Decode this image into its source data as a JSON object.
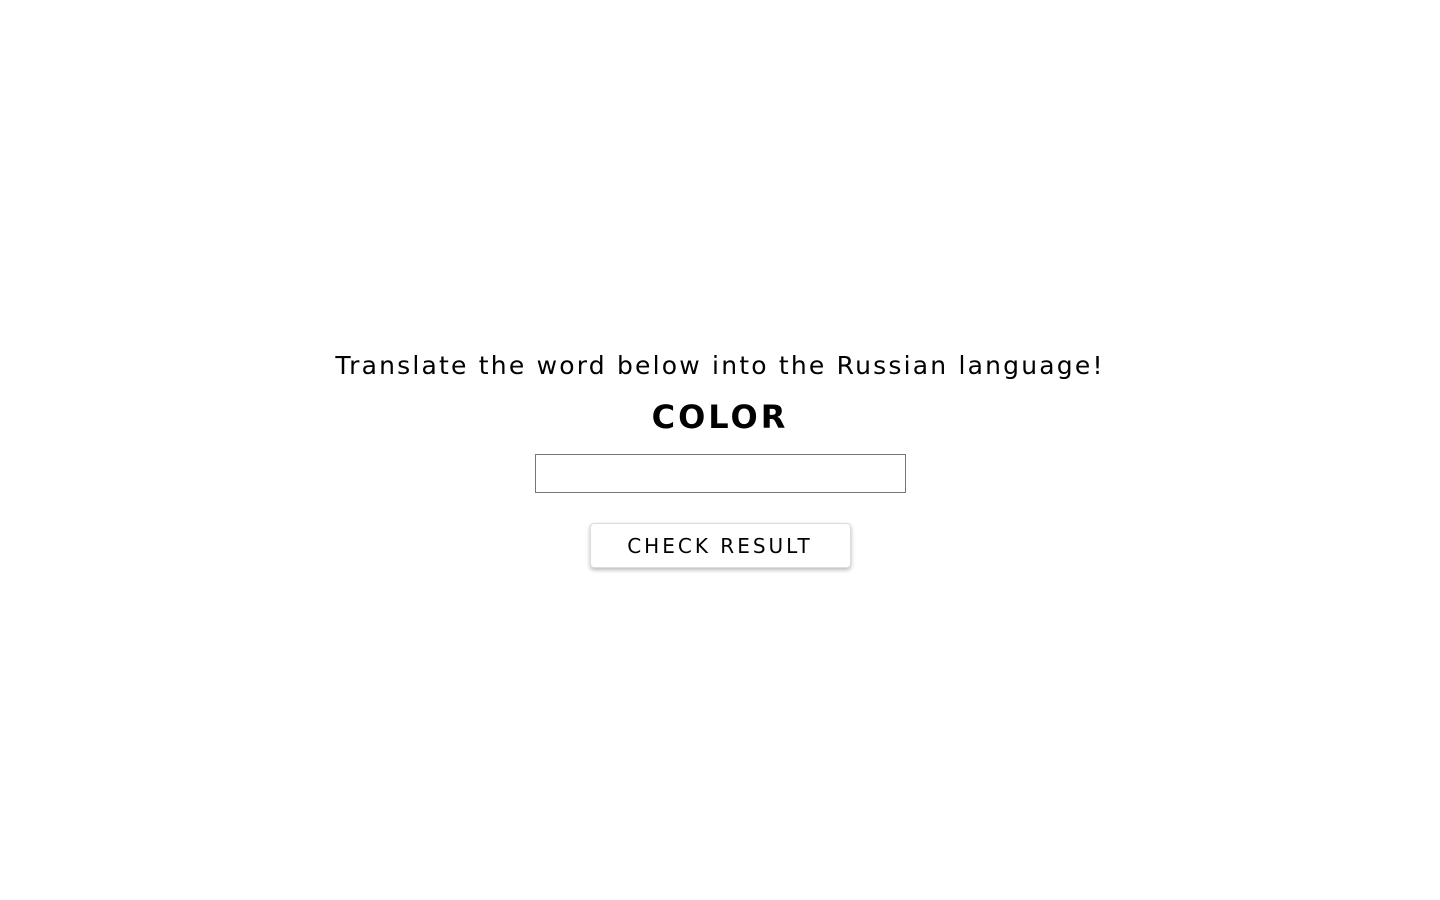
{
  "quiz": {
    "instruction": "Translate the word below into the Russian language!",
    "word": "COLOR",
    "answer_value": "",
    "answer_placeholder": "",
    "check_label": "CHECK RESULT"
  }
}
